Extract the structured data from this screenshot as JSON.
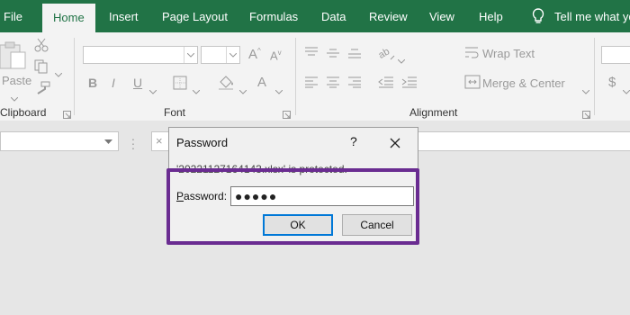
{
  "ribbon_tabs": [
    "File",
    "Home",
    "Insert",
    "Page Layout",
    "Formulas",
    "Data",
    "Review",
    "View",
    "Help",
    "Tell me what yo"
  ],
  "active_tab": "Home",
  "ribbon": {
    "clipboard": {
      "paste_label": "Paste",
      "group_label": "Clipboard"
    },
    "font": {
      "group_label": "Font",
      "bold": "B",
      "italic": "I",
      "underline": "U"
    },
    "alignment": {
      "group_label": "Alignment",
      "wrap_text": "Wrap Text",
      "merge_center": "Merge & Center"
    },
    "number": {
      "currency": "$"
    }
  },
  "dialog": {
    "title": "Password",
    "help": "?",
    "message": "'20221127164143.xlsx' is protected.",
    "password_label_accel": "P",
    "password_label_rest": "assword:",
    "password_value": "●●●●●",
    "ok_label": "OK",
    "cancel_label": "Cancel"
  },
  "colors": {
    "brand_green": "#217346",
    "highlight_purple": "#6a2c91",
    "default_button_border": "#0078d7"
  }
}
